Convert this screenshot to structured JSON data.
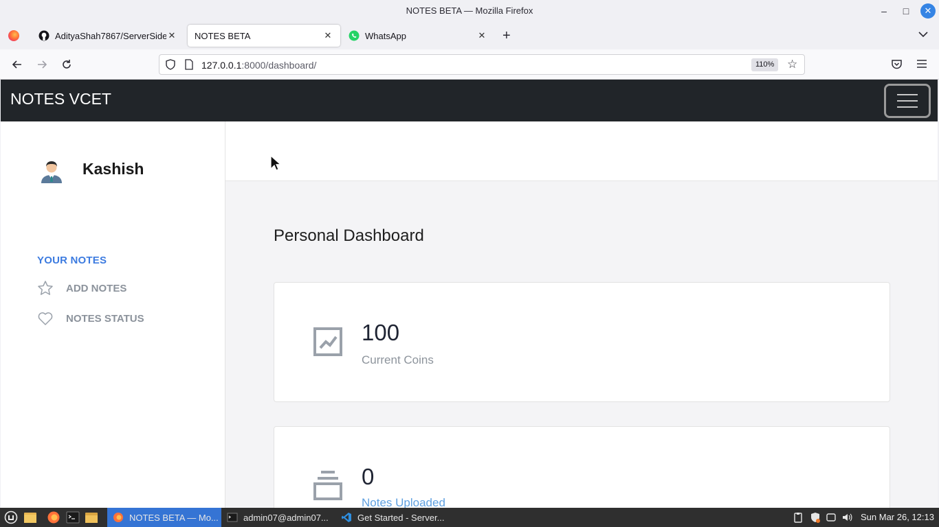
{
  "window": {
    "title": "NOTES BETA — Mozilla Firefox"
  },
  "tabs": [
    {
      "label": "AdityaShah7867/ServerSide",
      "icon": "github-icon"
    },
    {
      "label": "NOTES BETA",
      "icon": "none"
    },
    {
      "label": "WhatsApp",
      "icon": "whatsapp-icon"
    }
  ],
  "nav": {
    "url_host": "127.0.0.1",
    "url_rest": ":8000/dashboard/",
    "zoom": "110%"
  },
  "site": {
    "brand": "NOTES VCET",
    "user_name": "Kashish",
    "sidebar": {
      "section_title": "YOUR NOTES",
      "items": [
        {
          "label": "ADD NOTES",
          "icon": "star-icon"
        },
        {
          "label": "NOTES STATUS",
          "icon": "heart-icon"
        }
      ]
    },
    "dashboard": {
      "title": "Personal Dashboard",
      "cards": [
        {
          "value": "100",
          "caption": "Current Coins",
          "icon": "chart-icon"
        },
        {
          "value": "0",
          "caption": "Notes Uploaded",
          "icon": "stack-icon"
        }
      ]
    }
  },
  "taskbar": {
    "tasks": [
      {
        "label": "NOTES BETA — Mo..."
      },
      {
        "label": "admin07@admin07..."
      },
      {
        "label": "Get Started - Server..."
      }
    ],
    "clock": "Sun Mar 26, 12:13"
  },
  "colors": {
    "accent_blue": "#3c7be0",
    "header_dark": "#212529",
    "taskbar_active": "#3574d4"
  }
}
